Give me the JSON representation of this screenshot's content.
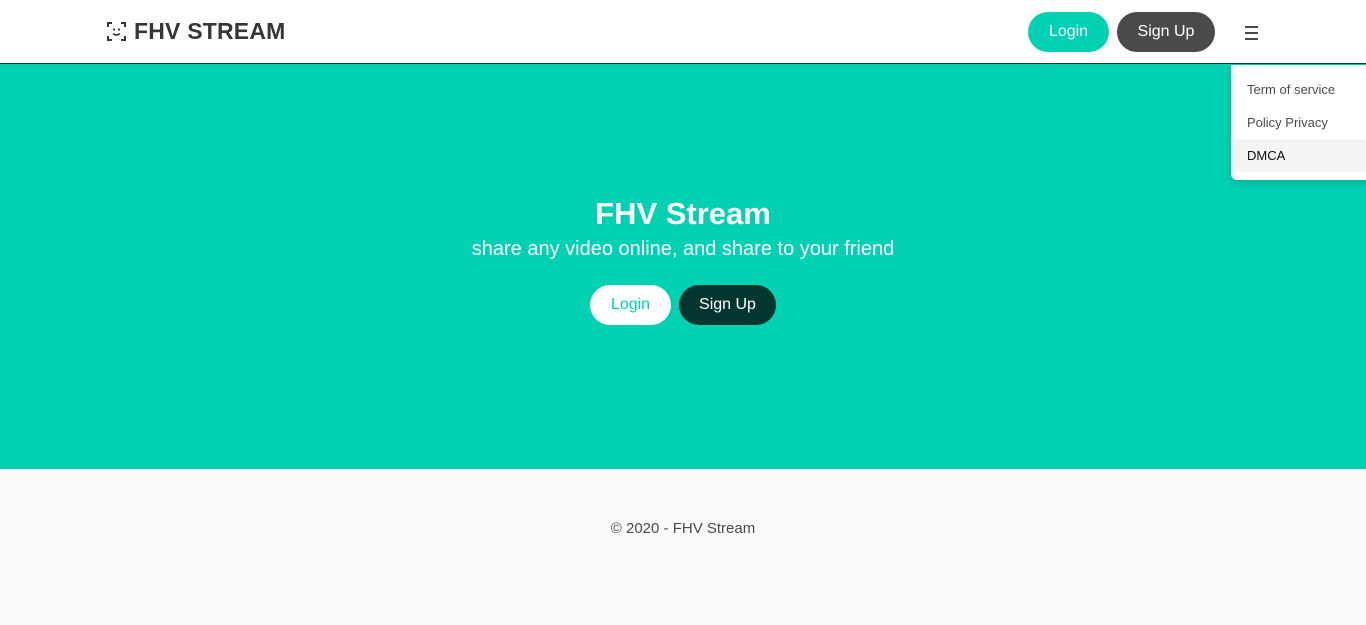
{
  "navbar": {
    "brand": {
      "icon": "face-scan-icon",
      "title": "FHV STREAM"
    },
    "login_label": "Login",
    "signup_label": "Sign Up",
    "menu_icon": "hamburger-menu-icon"
  },
  "dropdown": {
    "items": [
      {
        "label": "Term of service"
      },
      {
        "label": "Policy Privacy"
      },
      {
        "label": "DMCA"
      }
    ]
  },
  "hero": {
    "title": "FHV Stream",
    "subtitle": "share any video online, and share to your friend",
    "login_label": "Login",
    "signup_label": "Sign Up"
  },
  "footer": {
    "copyright": "© 2020 - FHV Stream"
  },
  "colors": {
    "primary": "#00d1b2",
    "dark": "#4a4a4a",
    "hero_signup": "#043630",
    "background": "#fafafa"
  }
}
